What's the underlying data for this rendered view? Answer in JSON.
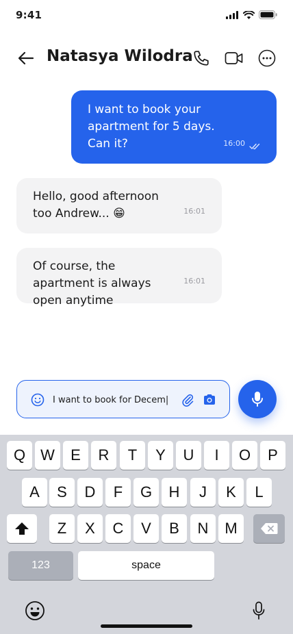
{
  "status_bar": {
    "time": "9:41"
  },
  "header": {
    "contact_name": "Natasya Wilodra",
    "icons": [
      "back-arrow-icon",
      "phone-icon",
      "video-camera-icon",
      "more-options-icon"
    ]
  },
  "messages": [
    {
      "direction": "outgoing",
      "text": "I want to book your apartment for 5 days. Can it?",
      "time": "16:00",
      "status": "read"
    },
    {
      "direction": "incoming",
      "text": "Hello, good afternoon too Andrew... 😁",
      "time": "16:01"
    },
    {
      "direction": "incoming",
      "text": "Of course, the apartment is always open anytime",
      "time": "16:01"
    }
  ],
  "composer": {
    "value": "I want to book for Decem|",
    "icons": [
      "emoji-icon",
      "paperclip-icon",
      "camera-icon",
      "microphone-icon"
    ]
  },
  "keyboard": {
    "row1": [
      "Q",
      "W",
      "E",
      "R",
      "T",
      "Y",
      "U",
      "I",
      "O",
      "P"
    ],
    "row2": [
      "A",
      "S",
      "D",
      "F",
      "G",
      "H",
      "J",
      "K",
      "L"
    ],
    "row3": [
      "Z",
      "X",
      "C",
      "V",
      "B",
      "N",
      "M"
    ],
    "numbers_label": "123",
    "space_label": "space"
  },
  "colors": {
    "accent": "#2563eb",
    "incoming_bubble": "#f3f3f4",
    "keyboard_bg": "#d3d5db",
    "composer_bg": "#eef3fd"
  }
}
